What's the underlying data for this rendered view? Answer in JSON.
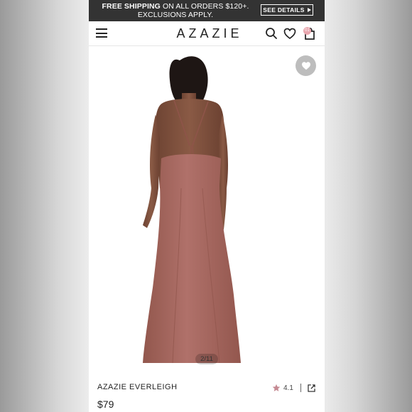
{
  "promo": {
    "bold": "FREE SHIPPING",
    "line1_rest": " ON ALL ORDERS $120+.",
    "line2": "EXCLUSIONS APPLY.",
    "button_label": "SEE DETAILS"
  },
  "header": {
    "logo": "AZAZIE",
    "cart_count": "01"
  },
  "gallery": {
    "counter": "2/11"
  },
  "product": {
    "name": "AZAZIE EVERLEIGH",
    "price": "$79",
    "rating": "4.1"
  },
  "colors": {
    "promo_bg": "#333333",
    "dress": "#a8675c",
    "star": "#c58a93"
  }
}
